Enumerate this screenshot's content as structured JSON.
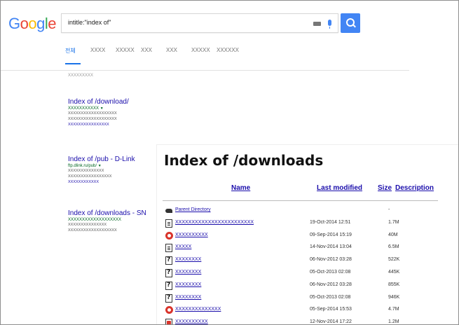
{
  "search": {
    "query": "intitle:\"index of\"",
    "tabs": [
      "전체",
      "XXXX",
      "XXXXX",
      "XXX",
      "XXX",
      "XXXXX",
      "XXXXXX"
    ],
    "stats": "XXXXXXXXX"
  },
  "results": [
    {
      "title": "Index of /download/",
      "url": "XXXXXXXXXXX",
      "snippet": [
        "XXXXXXXXXXXXXXXXXXX",
        "XXXXXXXXXXXXXXXXXXX"
      ],
      "links": "XXXXXXXXXXXXXXXX"
    },
    {
      "title": "Index of /pub - D-Link",
      "url": "ftp.dlink.ru/pub/",
      "snippet": [
        "XXXXXXXXXXXXXX",
        "XXXXXXXXXXXXXXXXX"
      ],
      "links": "XXXXXXXXXXXX"
    },
    {
      "title": "Index of /downloads - SN",
      "url": "XXXXXXXXXXXXXXXXXXX",
      "snippet": [
        "XXXXXXXXXXXXXXX",
        "XXXXXXXXXXXXXXXXXXX"
      ],
      "links": ""
    }
  ],
  "listing": {
    "title": "Index of /downloads",
    "headers": {
      "name": "Name",
      "modified": "Last modified",
      "size": "Size",
      "description": "Description"
    },
    "rows": [
      {
        "icon": "back",
        "name": "Parent Directory",
        "date": "",
        "size": "-"
      },
      {
        "icon": "doc",
        "name": "XXXXXXXXXXXXXXXXXXXXXXXX",
        "date": "19-Oct-2014 12:51",
        "size": "1.7M"
      },
      {
        "icon": "zip",
        "name": "XXXXXXXXXX",
        "date": "09-Sep-2014 15:19",
        "size": "40M"
      },
      {
        "icon": "doc",
        "name": "XXXXX",
        "date": "14-Nov-2014 13:04",
        "size": "6.5M"
      },
      {
        "icon": "unk",
        "name": "XXXXXXXX",
        "date": "06-Nov-2012 03:28",
        "size": "522K"
      },
      {
        "icon": "unk",
        "name": "XXXXXXXX",
        "date": "05-Oct-2013 02:08",
        "size": "445K"
      },
      {
        "icon": "unk",
        "name": "XXXXXXXX",
        "date": "06-Nov-2012 03:28",
        "size": "855K"
      },
      {
        "icon": "unk",
        "name": "XXXXXXXX",
        "date": "05-Oct-2013 02:08",
        "size": "946K"
      },
      {
        "icon": "zip",
        "name": "XXXXXXXXXXXXXX",
        "date": "05-Sep-2014 15:53",
        "size": "4.7M"
      },
      {
        "icon": "pdf",
        "name": "XXXXXXXXXX",
        "date": "12-Nov-2014 17:22",
        "size": "1.2M"
      }
    ]
  }
}
